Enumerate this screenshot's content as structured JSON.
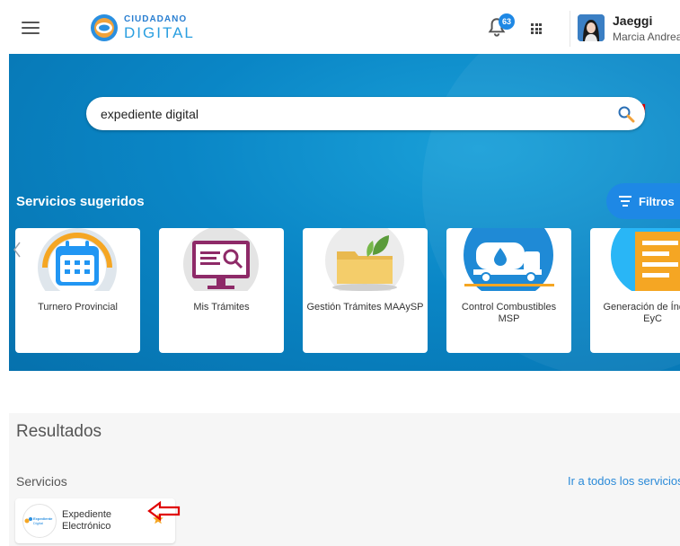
{
  "header": {
    "logo_top": "CIUDADANO",
    "logo_bottom": "DIGITAL",
    "notification_count": "63",
    "user_name": "Jaeggi",
    "user_subtitle": "Marcia Andrea"
  },
  "search": {
    "value": "expediente digital"
  },
  "suggested": {
    "title": "Servicios sugeridos",
    "filter_label": "Filtros",
    "cards": [
      {
        "label": "Turnero Provincial",
        "icon": "calendar-icon"
      },
      {
        "label": "Mis Trámites",
        "icon": "monitor-search-icon"
      },
      {
        "label": "Gestión Trámites MAAySP",
        "icon": "folder-leaf-icon"
      },
      {
        "label": "Control Combustibles MSP",
        "icon": "fuel-truck-icon"
      },
      {
        "label": "Generación de Índices EyC",
        "icon": "document-icon"
      }
    ]
  },
  "results": {
    "title": "Resultados",
    "services_title": "Servicios",
    "all_services_link": "Ir a todos los servicios",
    "items": [
      {
        "name": "Expediente Electrónico",
        "logo_text": "Expediente Digital"
      }
    ]
  },
  "colors": {
    "brand_blue": "#1e88e5",
    "banner_blue": "#0a86c6",
    "annotation_red": "#e00000",
    "star": "#f5a623"
  }
}
